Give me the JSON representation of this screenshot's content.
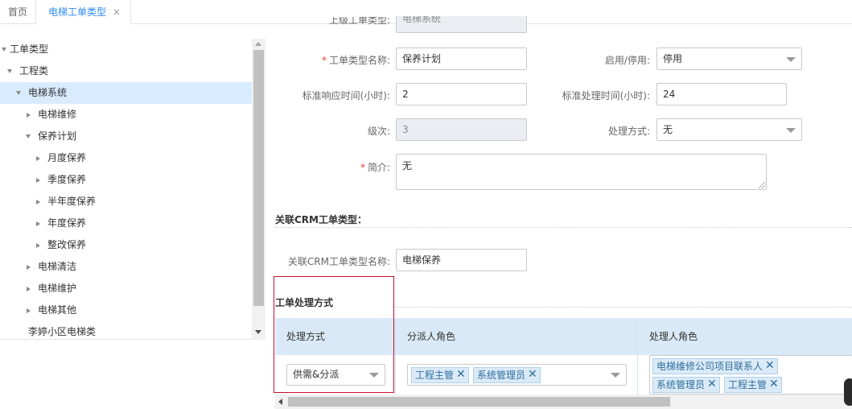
{
  "tabs": {
    "home": "首页",
    "active": "电梯工单类型",
    "close": "×"
  },
  "tree": {
    "items": [
      {
        "label": "工单类型",
        "icon": "triangle-down"
      },
      {
        "label": "工程类",
        "icon": "triangle-down"
      },
      {
        "label": "电梯系统",
        "icon": "triangle-down",
        "selected": true
      },
      {
        "label": "电梯维修",
        "icon": "triangle-right"
      },
      {
        "label": "保养计划",
        "icon": "triangle-down"
      },
      {
        "label": "月度保养",
        "icon": "triangle-right"
      },
      {
        "label": "季度保养",
        "icon": "triangle-right"
      },
      {
        "label": "半年度保养",
        "icon": "triangle-right"
      },
      {
        "label": "年度保养",
        "icon": "triangle-right"
      },
      {
        "label": "整改保养",
        "icon": "triangle-right"
      },
      {
        "label": "电梯清洁",
        "icon": "triangle-right"
      },
      {
        "label": "电梯维护",
        "icon": "triangle-right"
      },
      {
        "label": "电梯其他",
        "icon": "triangle-right"
      },
      {
        "label": "李婷小区电梯类",
        "icon": ""
      }
    ]
  },
  "form": {
    "parent_type": {
      "label": "上级工单类型:",
      "value": "电梯系统"
    },
    "type_name": {
      "required": "*",
      "label": "工单类型名称:",
      "value": "保养计划"
    },
    "enable": {
      "label": "启用/停用:",
      "value": "停用"
    },
    "response_time": {
      "label": "标准响应时间(小时):",
      "value": "2"
    },
    "process_time": {
      "label": "标准处理时间(小时):",
      "value": "24"
    },
    "level": {
      "label": "级次:",
      "value": "3"
    },
    "process_method": {
      "label": "处理方式:",
      "value": "无"
    },
    "intro": {
      "required": "*",
      "label": "简介:",
      "value": "无"
    }
  },
  "crm": {
    "section_title": "关联CRM工单类型：",
    "name_label": "关联CRM工单类型名称:",
    "name_value": "电梯保养"
  },
  "handling": {
    "section_title": "工单处理方式",
    "columns": [
      "处理方式",
      "分派人角色",
      "处理人角色"
    ],
    "row": {
      "method": "供需&分派",
      "dispatcher_roles": [
        "工程主管",
        "系统管理员"
      ],
      "handler_roles": [
        "电梯维修公司项目联系人",
        "系统管理员",
        "工程主管"
      ]
    }
  },
  "colors": {
    "accent": "#2d8cf0",
    "selected_row": "#d9ecff",
    "grid_header": "#d9e9f7",
    "chip_bg": "#dbeaf7",
    "highlight_box": "#c8102e"
  }
}
